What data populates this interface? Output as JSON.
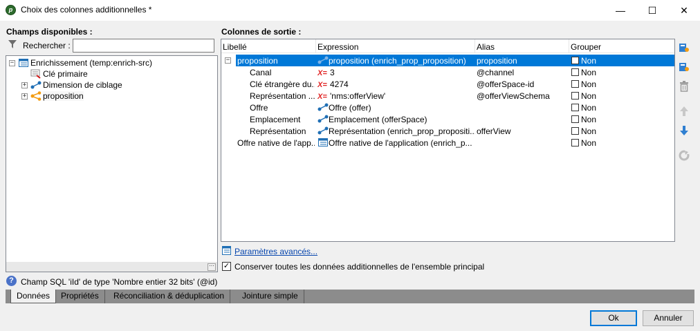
{
  "window": {
    "title": "Choix des colonnes additionnelles *",
    "app_icon_glyph": "p",
    "minimize": "—",
    "maximize": "☐",
    "close": "✕"
  },
  "left": {
    "section_label": "Champs disponibles :",
    "search_label": "Rechercher :",
    "search_value": "",
    "tree": [
      {
        "label": "Enrichissement (temp:enrich-src)",
        "expander": "−",
        "icon": "table-icon"
      },
      {
        "label": "Clé primaire",
        "icon": "primary-key-icon"
      },
      {
        "label": "Dimension de ciblage",
        "expander": "+",
        "icon": "link-icon"
      },
      {
        "label": "proposition",
        "expander": "+",
        "icon": "collection-link-icon"
      }
    ],
    "more_button": "···"
  },
  "right": {
    "section_label": "Colonnes de sortie :",
    "columns": [
      "Libellé",
      "Expression",
      "Alias",
      "Grouper"
    ],
    "rows": [
      {
        "label": "proposition",
        "expression": "proposition (enrich_prop_proposition)",
        "expr_icon": "link-icon",
        "alias": "proposition",
        "group": "Non",
        "expander": "−",
        "selected": true
      },
      {
        "label": "Canal",
        "expression": "3",
        "expr_icon": "x-equals-icon",
        "x_glyph": "X=",
        "alias": "@channel",
        "group": "Non"
      },
      {
        "label": "Clé étrangère du...",
        "expression": "4274",
        "expr_icon": "x-equals-icon",
        "x_glyph": "X=",
        "alias": "@offerSpace-id",
        "group": "Non"
      },
      {
        "label": "Représentation ...",
        "expression": "'nms:offerView'",
        "expr_icon": "x-equals-icon",
        "x_glyph": "X=",
        "alias": "@offerViewSchema",
        "group": "Non"
      },
      {
        "label": "Offre",
        "expression": "Offre (offer)",
        "expr_icon": "link-icon",
        "alias": "",
        "group": "Non"
      },
      {
        "label": "Emplacement",
        "expression": "Emplacement (offerSpace)",
        "expr_icon": "link-icon",
        "alias": "",
        "group": "Non"
      },
      {
        "label": "Représentation",
        "expression": "Représentation (enrich_prop_propositi...",
        "expr_icon": "link-icon",
        "alias": "offerView",
        "group": "Non"
      },
      {
        "label": "Offre native de l'app...",
        "expression": "Offre native de l'application (enrich_p...",
        "expr_icon": "table-icon",
        "alias": "",
        "group": "Non"
      }
    ],
    "advanced_link": "Paramètres avancés...",
    "keep_label": "Conserver toutes les données additionnelles de l'ensemble principal",
    "keep_checked": "✓"
  },
  "help": {
    "icon": "?",
    "text": "Champ SQL 'iId' de type 'Nombre entier 32 bits' (@id)"
  },
  "tabs": [
    "Données",
    "Propriétés",
    "Réconciliation & déduplication",
    "Jointure simple"
  ],
  "buttons": {
    "ok": "Ok",
    "cancel": "Annuler"
  },
  "colors": {
    "selection": "#0078d7",
    "link": "#0645ad",
    "accent_orange": "#f39c12",
    "icon_blue": "#1f6fb5"
  }
}
